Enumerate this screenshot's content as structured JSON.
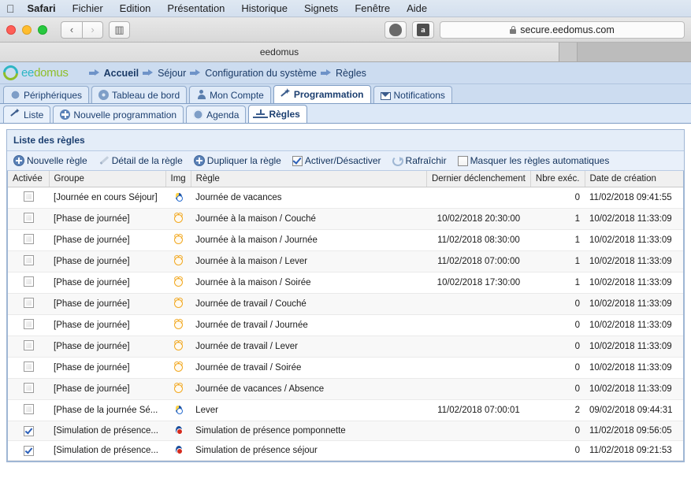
{
  "menubar": {
    "apple_icon": "apple-icon",
    "items": [
      {
        "label": "Safari",
        "bold": true
      },
      {
        "label": "Fichier",
        "bold": false
      },
      {
        "label": "Edition",
        "bold": false
      },
      {
        "label": "Présentation",
        "bold": false
      },
      {
        "label": "Historique",
        "bold": false
      },
      {
        "label": "Signets",
        "bold": false
      },
      {
        "label": "Fenêtre",
        "bold": false
      },
      {
        "label": "Aide",
        "bold": false
      }
    ]
  },
  "browser": {
    "back_glyph": "‹",
    "forward_glyph": "›",
    "sidebar_glyph": "▥",
    "favorites": [
      {
        "name": "shield-favorite-icon",
        "glyph": ""
      },
      {
        "name": "amazon-favorite-icon",
        "glyph": "a"
      }
    ],
    "url": "secure.eedomus.com",
    "tab_title": "eedomus"
  },
  "site_header": {
    "logo": "eedomus",
    "logo_first": "ee",
    "logo_rest": "domus",
    "breadcrumbs": [
      {
        "label": "Accueil",
        "bold": true
      },
      {
        "label": "Séjour",
        "bold": false
      },
      {
        "label": "Configuration du système",
        "bold": false
      },
      {
        "label": "Règles",
        "bold": false
      }
    ]
  },
  "primary_tabs": [
    {
      "label": "Périphériques",
      "icon": "gear-icon",
      "active": false
    },
    {
      "label": "Tableau de bord",
      "icon": "dashboard-icon",
      "active": false
    },
    {
      "label": "Mon Compte",
      "icon": "user-icon",
      "active": false
    },
    {
      "label": "Programmation",
      "icon": "wand-icon",
      "active": true
    },
    {
      "label": "Notifications",
      "icon": "mail-icon",
      "active": false
    }
  ],
  "secondary_tabs": [
    {
      "label": "Liste",
      "icon": "wand-icon",
      "active": false
    },
    {
      "label": "Nouvelle programmation",
      "icon": "plus-circle-icon",
      "active": false
    },
    {
      "label": "Agenda",
      "icon": "gear-icon",
      "active": false
    },
    {
      "label": "Règles",
      "icon": "tree-icon",
      "active": true
    }
  ],
  "panel": {
    "title": "Liste des règles",
    "tools": [
      {
        "label": "Nouvelle règle",
        "icon": "plus-circle-icon",
        "type": "button"
      },
      {
        "label": "Détail de la règle",
        "icon": "pencil-icon",
        "type": "button"
      },
      {
        "label": "Dupliquer la règle",
        "icon": "duplicate-icon",
        "type": "button"
      },
      {
        "label": "Activer/Désactiver",
        "icon": "checkbox-checked-icon",
        "type": "checkbox",
        "checked": true
      },
      {
        "label": "Rafraîchir",
        "icon": "refresh-icon",
        "type": "button"
      },
      {
        "label": "Masquer les règles automatiques",
        "icon": "checkbox-icon",
        "type": "checkbox",
        "checked": false
      }
    ]
  },
  "table": {
    "columns": [
      "Activée",
      "Groupe",
      "Img",
      "Règle",
      "Dernier déclenchement",
      "Nbre exéc.",
      "Date de création"
    ],
    "rows": [
      {
        "activee": false,
        "groupe": "[Journée en cours Séjour]",
        "img": "balloon-teal-icon",
        "regle": "Journée de vacances",
        "dernier": "",
        "nbre": "0",
        "creation": "11/02/2018 09:41:55"
      },
      {
        "activee": false,
        "groupe": "[Phase de journée]",
        "img": "alarm-clock-icon",
        "regle": "Journée à la maison / Couché",
        "dernier": "10/02/2018 20:30:00",
        "nbre": "1",
        "creation": "10/02/2018 11:33:09"
      },
      {
        "activee": false,
        "groupe": "[Phase de journée]",
        "img": "alarm-clock-icon",
        "regle": "Journée à la maison / Journée",
        "dernier": "11/02/2018 08:30:00",
        "nbre": "1",
        "creation": "10/02/2018 11:33:09"
      },
      {
        "activee": false,
        "groupe": "[Phase de journée]",
        "img": "alarm-clock-icon",
        "regle": "Journée à la maison / Lever",
        "dernier": "11/02/2018 07:00:00",
        "nbre": "1",
        "creation": "10/02/2018 11:33:09"
      },
      {
        "activee": false,
        "groupe": "[Phase de journée]",
        "img": "alarm-clock-icon",
        "regle": "Journée à la maison / Soirée",
        "dernier": "10/02/2018 17:30:00",
        "nbre": "1",
        "creation": "10/02/2018 11:33:09"
      },
      {
        "activee": false,
        "groupe": "[Phase de journée]",
        "img": "alarm-clock-icon",
        "regle": "Journée de travail / Couché",
        "dernier": "",
        "nbre": "0",
        "creation": "10/02/2018 11:33:09"
      },
      {
        "activee": false,
        "groupe": "[Phase de journée]",
        "img": "alarm-clock-icon",
        "regle": "Journée de travail / Journée",
        "dernier": "",
        "nbre": "0",
        "creation": "10/02/2018 11:33:09"
      },
      {
        "activee": false,
        "groupe": "[Phase de journée]",
        "img": "alarm-clock-icon",
        "regle": "Journée de travail / Lever",
        "dernier": "",
        "nbre": "0",
        "creation": "10/02/2018 11:33:09"
      },
      {
        "activee": false,
        "groupe": "[Phase de journée]",
        "img": "alarm-clock-icon",
        "regle": "Journée de travail / Soirée",
        "dernier": "",
        "nbre": "0",
        "creation": "10/02/2018 11:33:09"
      },
      {
        "activee": false,
        "groupe": "[Phase de journée]",
        "img": "alarm-clock-icon",
        "regle": "Journée de vacances / Absence",
        "dernier": "",
        "nbre": "0",
        "creation": "10/02/2018 11:33:09"
      },
      {
        "activee": false,
        "groupe": "[Phase de la journée Sé...",
        "img": "balloon-teal-icon",
        "regle": "Lever",
        "dernier": "11/02/2018 07:00:01",
        "nbre": "2",
        "creation": "09/02/2018 09:44:31"
      },
      {
        "activee": true,
        "groupe": "[Simulation de présence...",
        "img": "balloon-red-icon",
        "regle": "Simulation de présence pomponnette",
        "dernier": "",
        "nbre": "0",
        "creation": "11/02/2018 09:56:05"
      },
      {
        "activee": true,
        "groupe": "[Simulation de présence...",
        "img": "balloon-red-icon",
        "regle": "Simulation de présence séjour",
        "dernier": "",
        "nbre": "0",
        "creation": "11/02/2018 09:21:53"
      }
    ]
  },
  "colors": {
    "accent_blue": "#1c3f70",
    "header_bg": "#ccdcf0",
    "panel_border": "#9fb6d4",
    "logo_green": "#8fbe2a",
    "logo_teal": "#2eb6c4",
    "clock_orange": "#f2a922",
    "check_blue": "#2b5fb8"
  }
}
